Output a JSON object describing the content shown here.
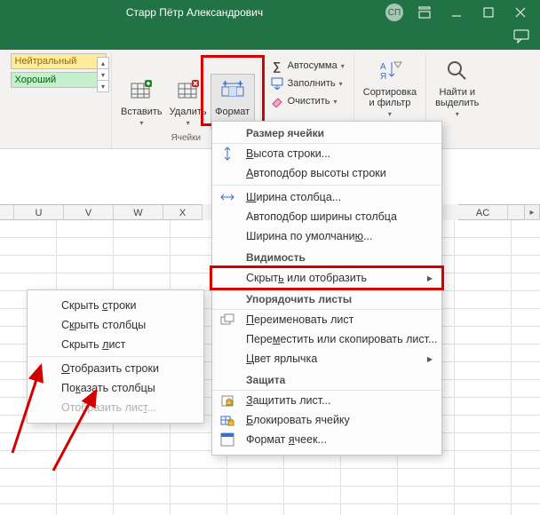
{
  "titlebar": {
    "title": "Старр Пётр Александрович",
    "user_initials": "СП"
  },
  "ribbon": {
    "styles": {
      "neutral": "Нейтральный",
      "good": "Хороший"
    },
    "cells_group_label": "Ячейки",
    "insert": "Вставить",
    "delete": "Удалить",
    "format": "Формат",
    "autosum": "Автосумма",
    "fill": "Заполнить",
    "clear": "Очистить",
    "sort_filter_line1": "Сортировка",
    "sort_filter_line2": "и фильтр",
    "find_select_line1": "Найти и",
    "find_select_line2": "выделить"
  },
  "columns_left": [
    "U",
    "V",
    "W",
    "X"
  ],
  "columns_right": [
    "AC"
  ],
  "format_menu": {
    "sec_size": "Размер ячейки",
    "row_height": "Высота строки...",
    "autofit_row": "Автоподбор высоты строки",
    "col_width": "Ширина столбца...",
    "autofit_col": "Автоподбор ширины столбца",
    "default_width": "Ширина по умолчанию...",
    "sec_visibility": "Видимость",
    "hide_unhide": "Скрыть или отобразить",
    "sec_organize": "Упорядочить листы",
    "rename": "Переименовать лист",
    "move_copy": "Переместить или скопировать лист...",
    "tab_color": "Цвет ярлычка",
    "sec_protect": "Защита",
    "protect_sheet": "Защитить лист...",
    "lock_cell": "Блокировать ячейку",
    "format_cells": "Формат ячеек..."
  },
  "hide_menu": {
    "hide_rows": "Скрыть строки",
    "hide_cols": "Скрыть столбцы",
    "hide_sheet": "Скрыть лист",
    "unhide_rows": "Отобразить строки",
    "unhide_cols": "Показать столбцы",
    "unhide_sheet": "Отобразить лист..."
  }
}
